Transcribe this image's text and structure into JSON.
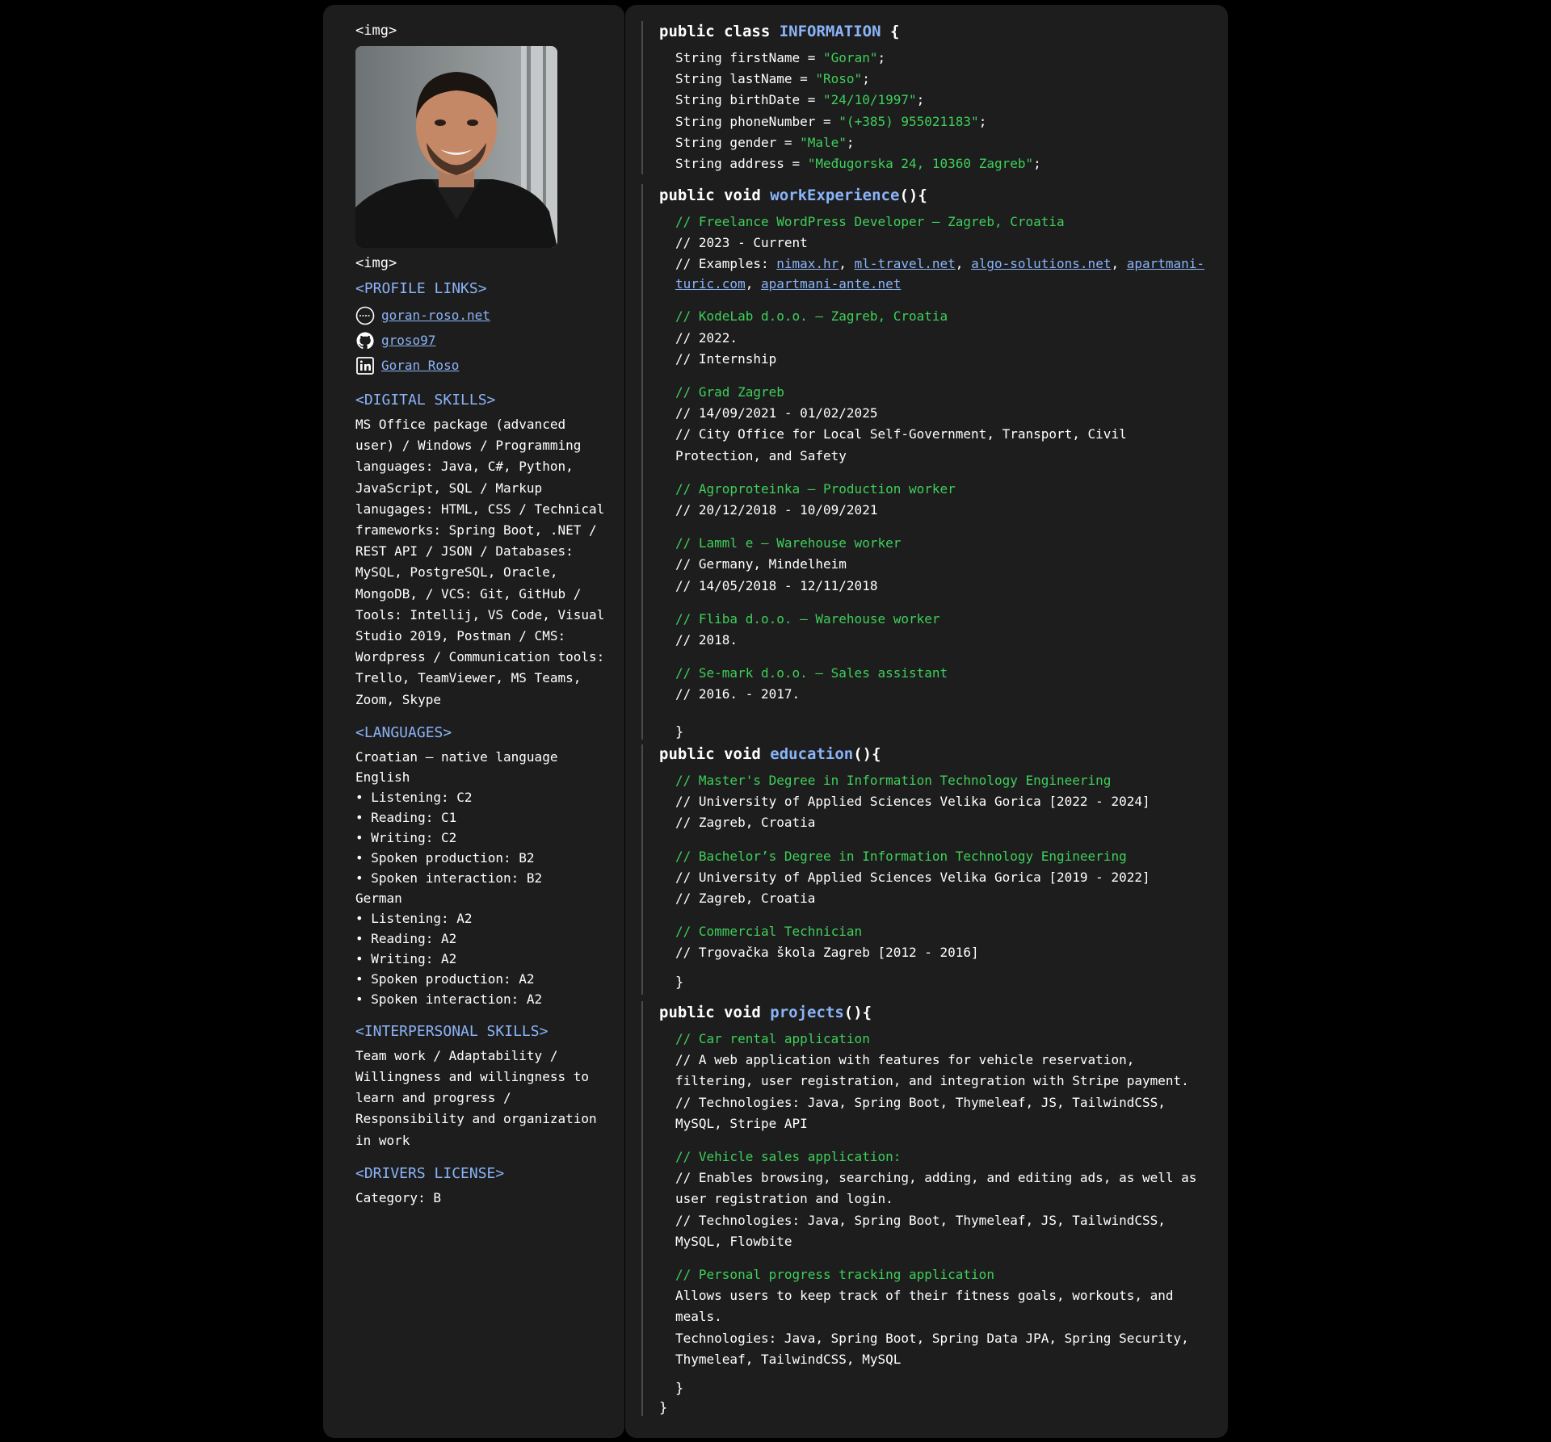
{
  "left": {
    "img_tag_top": "<img>",
    "img_tag_bottom": "<img>",
    "profile_links": {
      "heading": "<PROFILE LINKS>",
      "website": "goran-roso.net",
      "github": "groso97",
      "linkedin": "Goran Roso"
    },
    "digital_skills": {
      "heading": "<DIGITAL SKILLS>",
      "lines": [
        "MS Office package (advanced",
        "user) / Windows / Programming",
        "languages: Java, C#, Python,",
        "JavaScript, SQL / Markup",
        "lanugages: HTML, CSS / Technical",
        "frameworks: Spring Boot, .NET /",
        "REST API / JSON / Databases:",
        "MySQL, PostgreSQL, Oracle,",
        "MongoDB, / VCS: Git, GitHub /",
        "Tools: Intellij, VS Code, Visual",
        "Studio 2019, Postman / CMS:",
        "Wordpress / Communication tools:",
        "Trello, TeamViewer, MS Teams,",
        "Zoom, Skype"
      ]
    },
    "languages": {
      "heading": "<LANGUAGES>",
      "lines": [
        "Croatian – native language",
        "English",
        "• Listening: C2",
        "• Reading: C1",
        "• Writing: C2",
        "• Spoken production: B2",
        "• Spoken interaction: B2",
        "German",
        "• Listening: A2",
        "• Reading: A2",
        "• Writing: A2",
        "• Spoken production: A2",
        "• Spoken interaction: A2"
      ]
    },
    "interpersonal": {
      "heading": "<INTERPERSONAL SKILLS>",
      "lines": [
        "Team work / Adaptability /",
        "Willingness and willingness to",
        "learn and progress /",
        "Responsibility and organization",
        "in work"
      ]
    },
    "drivers": {
      "heading": "<DRIVERS LICENSE>",
      "category": "Category: B"
    }
  },
  "right": {
    "info": {
      "kw": "public class ",
      "name": "INFORMATION",
      "open": " {",
      "fields": [
        {
          "decl": "String firstName = ",
          "value": "\"Goran\""
        },
        {
          "decl": "String lastName = ",
          "value": "\"Roso\""
        },
        {
          "decl": "String birthDate = ",
          "value": "\"24/10/1997\""
        },
        {
          "decl": "String phoneNumber = ",
          "value": "\"(+385) 955021183\""
        },
        {
          "decl": "String gender = ",
          "value": "\"Male\""
        },
        {
          "decl": "String address = ",
          "value": "\"Međugorska 24, 10360 Zagreb\""
        }
      ]
    },
    "work": {
      "kw": "public void ",
      "name": "workExperience",
      "open": "(){",
      "jobs": [
        {
          "title": "// Freelance WordPress Developer – Zagreb, Croatia",
          "lines": [
            "// 2023 - Current"
          ],
          "examples_prefix": "// Examples: ",
          "links": [
            "nimax.hr",
            "ml-travel.net",
            "algo-solutions.net",
            "apartmani-turic.com",
            "apartmani-ante.net"
          ]
        },
        {
          "title": "// KodeLab d.o.o. – Zagreb, Croatia",
          "lines": [
            "// 2022.",
            "// Internship"
          ]
        },
        {
          "title": "// Grad Zagreb",
          "lines": [
            "// 14/09/2021 - 01/02/2025",
            "// City Office for Local Self-Government, Transport, Civil",
            "Protection, and Safety"
          ]
        },
        {
          "title": "// Agroproteinka – Production worker",
          "lines": [
            "// 20/12/2018 - 10/09/2021"
          ]
        },
        {
          "title": "// Lamml e – Warehouse worker",
          "lines": [
            "// Germany, Mindelheim",
            "// 14/05/2018 - 12/11/2018"
          ]
        },
        {
          "title": "// Fliba d.o.o. – Warehouse worker",
          "lines": [
            "// 2018."
          ]
        },
        {
          "title": "// Se-mark d.o.o. – Sales assistant",
          "lines": [
            "// 2016. - 2017."
          ]
        }
      ],
      "close": "}"
    },
    "education": {
      "kw": "public void ",
      "name": "education",
      "open": "(){",
      "items": [
        {
          "title": "// Master's Degree in Information Technology Engineering",
          "lines": [
            "// University of Applied Sciences Velika Gorica [2022 - 2024]",
            "// Zagreb, Croatia"
          ]
        },
        {
          "title": "// Bachelor’s Degree in Information Technology Engineering",
          "lines": [
            "// University of Applied Sciences Velika Gorica [2019 - 2022]",
            "// Zagreb, Croatia"
          ]
        },
        {
          "title": "// Commercial Technician",
          "lines": [
            "// Trgovačka škola Zagreb [2012 - 2016]"
          ]
        }
      ],
      "close": "}"
    },
    "projects": {
      "kw": "public void ",
      "name": "projects",
      "open": "(){",
      "items": [
        {
          "title": "// Car rental application",
          "lines": [
            "// A web application with features for vehicle reservation,",
            "filtering, user registration, and integration with Stripe payment.",
            "// Technologies: Java, Spring Boot, Thymeleaf, JS, TailwindCSS,",
            "MySQL, Stripe API"
          ]
        },
        {
          "title": "// Vehicle sales application:",
          "lines": [
            "// Enables browsing, searching, adding, and editing ads, as well as",
            "user registration and login.",
            "// Technologies: Java, Spring Boot, Thymeleaf, JS, TailwindCSS,",
            "MySQL, Flowbite"
          ]
        },
        {
          "title": "// Personal progress tracking application",
          "lines": [
            "Allows users to keep track of their fitness goals, workouts, and",
            "meals.",
            "Technologies: Java, Spring Boot, Spring Data JPA, Spring Security,",
            "Thymeleaf, TailwindCSS, MySQL"
          ]
        }
      ],
      "close": "}"
    },
    "class_close": "}"
  },
  "colors": {
    "background": "#000000",
    "panel": "#1d1d1d",
    "accent": "#8ab4f8",
    "comment": "#3ecf5a",
    "text": "#ffffff"
  }
}
